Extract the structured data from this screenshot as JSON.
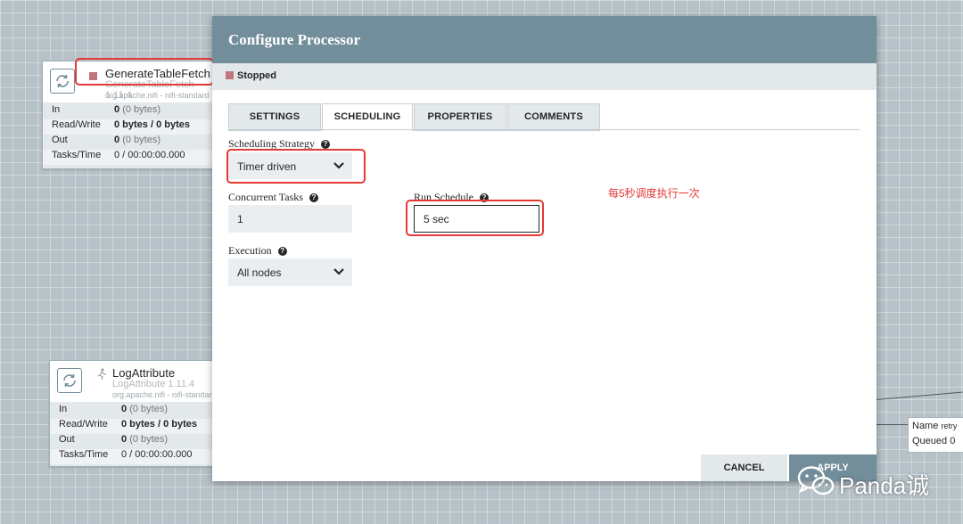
{
  "canvas": {
    "processor1": {
      "name": "GenerateTableFetch",
      "type": "GenerateTableFetch 1.11.4",
      "bundle": "org.apache.nifi - nifi-standard",
      "stats": [
        {
          "key": "In",
          "value": "0",
          "detail": "(0 bytes)"
        },
        {
          "key": "Read/Write",
          "value": "0 bytes / 0 bytes",
          "detail": ""
        },
        {
          "key": "Out",
          "value": "0",
          "detail": "(0 bytes)"
        },
        {
          "key": "Tasks/Time",
          "value": "0 / 00:00:00.000",
          "detail": ""
        }
      ]
    },
    "processor2": {
      "name": "LogAttribute",
      "type": "LogAttribute 1.11.4",
      "bundle": "org.apache.nifi - nifi-standard",
      "stats": [
        {
          "key": "In",
          "value": "0",
          "detail": "(0 bytes)"
        },
        {
          "key": "Read/Write",
          "value": "0 bytes / 0 bytes",
          "detail": ""
        },
        {
          "key": "Out",
          "value": "0",
          "detail": "(0 bytes)"
        },
        {
          "key": "Tasks/Time",
          "value": "0 / 00:00:00.000",
          "detail": ""
        }
      ]
    },
    "connection": {
      "name_key": "Name",
      "name_value": "retry",
      "queued_key": "Queued",
      "queued_value": "0"
    }
  },
  "dialog": {
    "title": "Configure Processor",
    "status": "Stopped",
    "tabs": [
      "SETTINGS",
      "SCHEDULING",
      "PROPERTIES",
      "COMMENTS"
    ],
    "active_tab": "SCHEDULING",
    "scheduling_strategy": {
      "label": "Scheduling Strategy",
      "value": "Timer driven"
    },
    "concurrent_tasks": {
      "label": "Concurrent Tasks",
      "value": "1"
    },
    "run_schedule": {
      "label": "Run Schedule",
      "value": "5 sec"
    },
    "execution": {
      "label": "Execution",
      "value": "All nodes"
    },
    "annotation": "每5秒调度执行一次",
    "buttons": {
      "cancel": "CANCEL",
      "apply": "APPLY"
    }
  },
  "watermark": {
    "text": "Panda诚"
  },
  "colors": {
    "accent": "#728e9b",
    "stopped": "#c0747c",
    "highlight": "#e53935"
  },
  "icons": {
    "refresh": "refresh-icon",
    "help": "help-icon",
    "chevron": "chevron-down-icon",
    "wechat": "wechat-icon"
  }
}
